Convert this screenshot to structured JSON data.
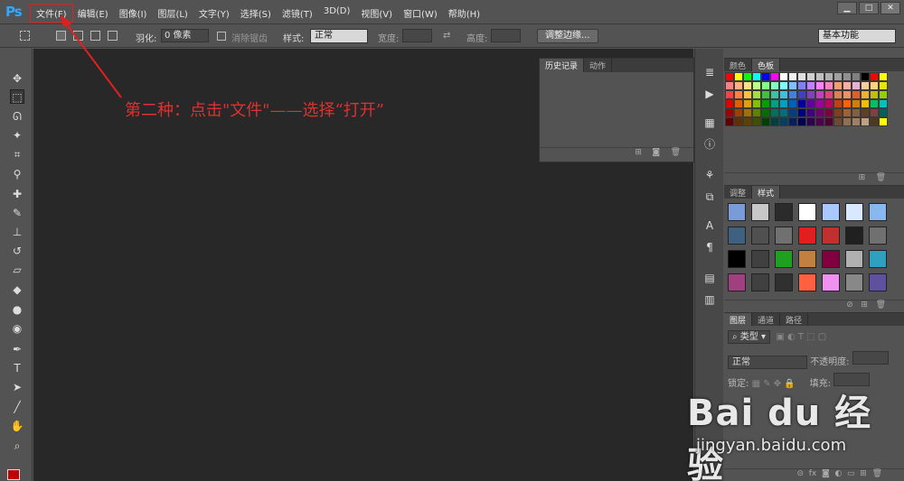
{
  "app": {
    "logo": "Ps"
  },
  "menubar": {
    "items": [
      "文件(F)",
      "编辑(E)",
      "图像(I)",
      "图层(L)",
      "文字(Y)",
      "选择(S)",
      "滤镜(T)",
      "3D(D)",
      "视图(V)",
      "窗口(W)",
      "帮助(H)"
    ],
    "highlighted": "文件(F)"
  },
  "window_controls": {
    "minimize": "▁",
    "maximize": "□",
    "close": "✕"
  },
  "options": {
    "feather_label": "羽化:",
    "feather_value": "0 像素",
    "antialias_label": "消除锯齿",
    "style_label": "样式:",
    "style_value": "正常",
    "width_label": "宽度:",
    "height_label": "高度:",
    "refine_edge_button": "调整边缘...",
    "workspace": "基本功能"
  },
  "annotation": {
    "text": "第二种：点击\"文件\"——选择“打开”",
    "color": "#e03030"
  },
  "history_panel": {
    "tabs": [
      "历史记录",
      "动作"
    ],
    "active_tab": "历史记录"
  },
  "swatches_panel": {
    "tabs": [
      "颜色",
      "色板"
    ],
    "active_tab": "色板",
    "colors": [
      "#ff0000",
      "#ffff00",
      "#00ff00",
      "#00ffff",
      "#0000ff",
      "#ff00ff",
      "#ffffff",
      "#f0f0f0",
      "#e0e0e0",
      "#d0d0d0",
      "#c0c0c0",
      "#b0b0b0",
      "#a0a0a0",
      "#909090",
      "#808080",
      "#000000",
      "#ff0000",
      "#ffff00",
      "#ff8080",
      "#ffb080",
      "#ffe080",
      "#c0ff80",
      "#80ff80",
      "#80ffc0",
      "#80ffff",
      "#80c0ff",
      "#8080ff",
      "#c080ff",
      "#ff80ff",
      "#ff80c0",
      "#f0a070",
      "#f4b0a0",
      "#e8b0d0",
      "#ffcc99",
      "#ffd27f",
      "#e6e600",
      "#ff4040",
      "#ff8040",
      "#ffc040",
      "#a0e040",
      "#40c040",
      "#40c0a0",
      "#40c0e0",
      "#4080e0",
      "#4040c0",
      "#8040c0",
      "#c040c0",
      "#e04080",
      "#e08050",
      "#f09060",
      "#e06020",
      "#f0b030",
      "#c0c000",
      "#90d000",
      "#e00000",
      "#e06000",
      "#e0a000",
      "#80c000",
      "#00a000",
      "#00a080",
      "#00a0c0",
      "#0060c0",
      "#0000a0",
      "#6000a0",
      "#a000a0",
      "#c00060",
      "#c04010",
      "#ff6000",
      "#d08000",
      "#f0c000",
      "#00c060",
      "#00c0c0",
      "#a00000",
      "#a04000",
      "#a07000",
      "#608000",
      "#007000",
      "#007060",
      "#007080",
      "#004080",
      "#000080",
      "#400080",
      "#700070",
      "#800040",
      "#804020",
      "#a06030",
      "#806040",
      "#604020",
      "#804040",
      "#006060",
      "#600000",
      "#603000",
      "#604000",
      "#405000",
      "#004000",
      "#004040",
      "#004060",
      "#002060",
      "#000050",
      "#300050",
      "#500050",
      "#500030",
      "#704830",
      "#907050",
      "#a08060",
      "#c0a080",
      "#503828",
      "#ffff00"
    ]
  },
  "styles_panel": {
    "tabs": [
      "调整",
      "样式"
    ],
    "active_tab": "样式",
    "styles": [
      "#7a9ad8",
      "#c8c8c8",
      "#2b2b2b",
      "#ffffff",
      "#a8c8ff",
      "#d8e8ff",
      "#88b8f0",
      "#406080",
      "#505050",
      "#707070",
      "#e02020",
      "#c03030",
      "#202020",
      "#707070",
      "#000000",
      "#404040",
      "#20a020",
      "#c08040",
      "#800040",
      "#b0b0b0",
      "#30a0c0",
      "#a04080",
      "#404040",
      "#303030",
      "#ff6040",
      "#f090f0",
      "#888888",
      "#6050a0"
    ]
  },
  "layers_panel": {
    "tabs": [
      "图层",
      "通道",
      "路径"
    ],
    "active_tab": "图层",
    "kind_label": "类型",
    "blend_mode": "正常",
    "opacity_label": "不透明度:",
    "lock_label": "锁定:",
    "fill_label": "填充:"
  },
  "watermark": {
    "brand": "Bai du 经验",
    "url": "jingyan.baidu.com"
  }
}
